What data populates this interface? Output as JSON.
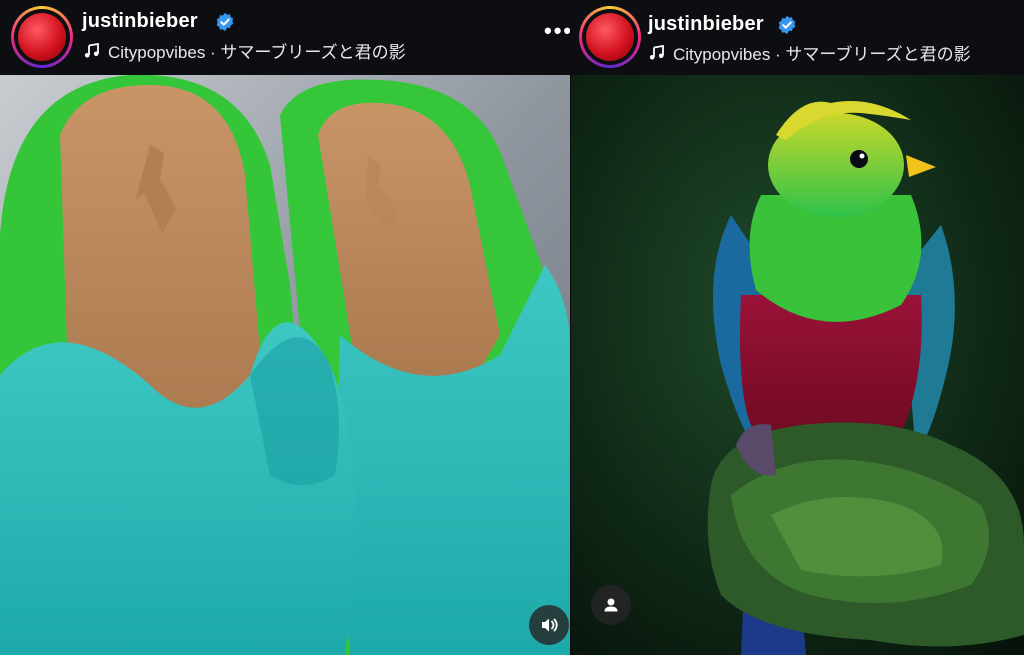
{
  "posts": [
    {
      "username": "justinbieber",
      "audio_label": "Citypopvibes · サマーブリーズと君の影",
      "media_description_icon": "sound-on-icon"
    },
    {
      "username": "justinbieber",
      "audio_label": "Citypopvibes · サマーブリーズと君の影",
      "media_description_icon": "user-tag-icon"
    }
  ],
  "more_label": "•••",
  "colors": {
    "header_bg": "#0d0e12",
    "verified_blue": "#3797f0",
    "avatar_red": "#d3121f"
  }
}
